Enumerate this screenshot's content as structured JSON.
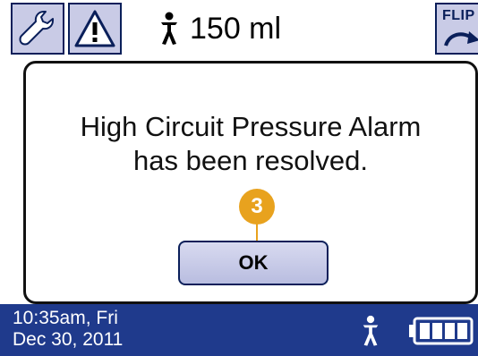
{
  "top_bar": {
    "volume": "150 ml",
    "flip_label": "FLIP"
  },
  "dialog": {
    "message_line1": "High Circuit Pressure Alarm",
    "message_line2": "has been resolved.",
    "step_badge": "3",
    "ok_label": "OK"
  },
  "status_bar": {
    "time_day": "10:35am, Fri",
    "date": "Dec 30, 2011",
    "battery_level": 1.0
  },
  "icons": {
    "settings": "wrench-icon",
    "alarm": "warning-triangle-icon",
    "patient": "patient-figure-icon",
    "flip": "flip-arrow-icon",
    "battery": "battery-icon"
  },
  "colors": {
    "status_bar": "#1f3a8c",
    "button_fill": "#c9cbe6",
    "button_border": "#0a1f5a",
    "badge": "#e8a21e"
  }
}
